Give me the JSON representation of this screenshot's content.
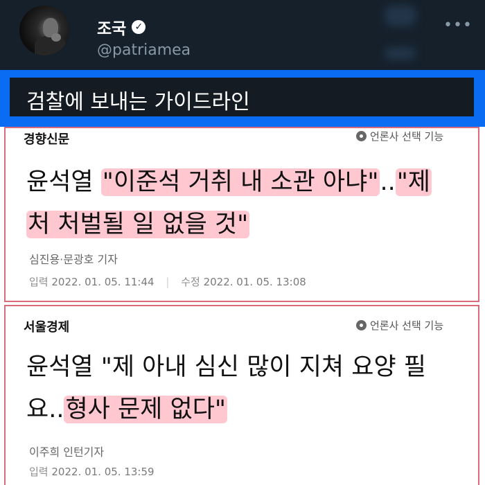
{
  "tweet": {
    "author_name": "조국",
    "handle": "@patriamea",
    "more_label": "•••"
  },
  "banner": {
    "text": "검찰에 보내는 가이드라인"
  },
  "articles": [
    {
      "publisher": "경향신문",
      "select_label": "언론사 선택 기능",
      "headline_parts": [
        "윤석열 ",
        "\"이준석 거취 내 소관 아냐\"",
        "..",
        "\"제",
        "처 처벌될 일 없을 것\""
      ],
      "reporter": "심진용·문광호 기자",
      "input_label": "입력",
      "input_date": "2022. 01. 05. 11:44",
      "edit_label": "수정",
      "edit_date": "2022. 01. 05. 13:08"
    },
    {
      "publisher": "서울경제",
      "select_label": "언론사 선택 기능",
      "headline_parts": [
        "윤석열 \"제 아내 심신 많이 지쳐 요양 필",
        "요..",
        "형사 문제 없다\""
      ],
      "reporter": "이주희 인턴기자",
      "input_label": "입력",
      "input_date": "2022. 01. 05. 13:59"
    }
  ],
  "colors": {
    "background": "#15202b",
    "banner_border": "#0a6cf2",
    "card_border": "#d96a7a",
    "highlight": "#ffaab9"
  }
}
